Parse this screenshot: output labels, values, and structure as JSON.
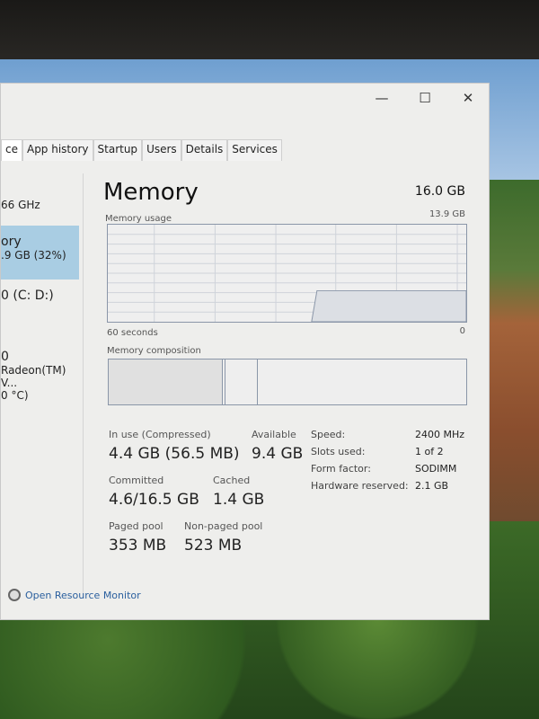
{
  "window": {
    "controls": {
      "minimize": "—",
      "maximize": "☐",
      "close": "✕"
    }
  },
  "tabs": [
    {
      "label": "ce",
      "active": true
    },
    {
      "label": "App history"
    },
    {
      "label": "Startup"
    },
    {
      "label": "Users"
    },
    {
      "label": "Details"
    },
    {
      "label": "Services"
    }
  ],
  "sidebar": {
    "items": [
      {
        "line1": "66 GHz"
      },
      {
        "line1": "ory",
        "line2": ".9 GB (32%)",
        "selected": true
      },
      {
        "line1": "0 (C: D:)"
      },
      {
        "line1": "0",
        "line2": "Radeon(TM) V...",
        "line3": "0 °C)"
      }
    ]
  },
  "main": {
    "title": "Memory",
    "total": "16.0 GB",
    "usage_label": "Memory usage",
    "usage_max": "13.9 GB",
    "time_label": "60 seconds",
    "min_label": "0",
    "usage_fraction": 0.32,
    "composition_label": "Memory composition",
    "stats": {
      "in_use_label": "In use (Compressed)",
      "in_use": "4.4 GB (56.5 MB)",
      "available_label": "Available",
      "available": "9.4 GB",
      "committed_label": "Committed",
      "committed": "4.6/16.5 GB",
      "cached_label": "Cached",
      "cached": "1.4 GB",
      "paged_label": "Paged pool",
      "paged": "353 MB",
      "nonpaged_label": "Non-paged pool",
      "nonpaged": "523 MB"
    },
    "specs": [
      {
        "k": "Speed:",
        "v": "2400 MHz"
      },
      {
        "k": "Slots used:",
        "v": "1 of 2"
      },
      {
        "k": "Form factor:",
        "v": "SODIMM"
      },
      {
        "k": "Hardware reserved:",
        "v": "2.1 GB"
      }
    ]
  },
  "footer": {
    "link": "Open Resource Monitor"
  },
  "colors": {
    "selected": "#a9cde3",
    "graph_border": "#8a96a8",
    "link": "#2a5f9e"
  }
}
